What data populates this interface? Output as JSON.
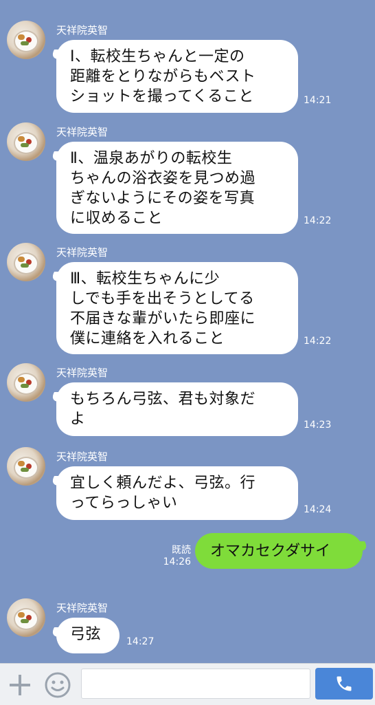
{
  "messages": [
    {
      "sender": "天祥院英智",
      "text": "Ⅰ、転校生ちゃんと一定の\n距離をとりながらもベスト\nショットを撮ってくること",
      "time": "14:21"
    },
    {
      "sender": "天祥院英智",
      "text": "Ⅱ、温泉あがりの転校生\nちゃんの浴衣姿を見つめ過\nぎないようにその姿を写真\nに収めること",
      "time": "14:22"
    },
    {
      "sender": "天祥院英智",
      "text": "Ⅲ、転校生ちゃんに少\nしでも手を出そうとしてる\n不届きな輩がいたら即座に\n僕に連絡を入れること",
      "time": "14:22"
    },
    {
      "sender": "天祥院英智",
      "text": "もちろん弓弦、君も対象だ\nよ",
      "time": "14:23"
    },
    {
      "sender": "天祥院英智",
      "text": "宜しく頼んだよ、弓弦。行\nってらっしゃい",
      "time": "14:24"
    }
  ],
  "outgoing": {
    "text": "オマカセクダサイ",
    "read_label": "既読",
    "time": "14:26"
  },
  "last_message": {
    "sender": "天祥院英智",
    "text": "弓弦",
    "time": "14:27"
  },
  "input": {
    "placeholder": "",
    "value": ""
  },
  "icons": {
    "add": "plus-icon",
    "emoji": "smiley-icon",
    "call": "phone-icon"
  },
  "colors": {
    "background": "#7b95c4",
    "outgoing_bubble": "#7fdc3a",
    "send_button": "#4a86d8"
  }
}
